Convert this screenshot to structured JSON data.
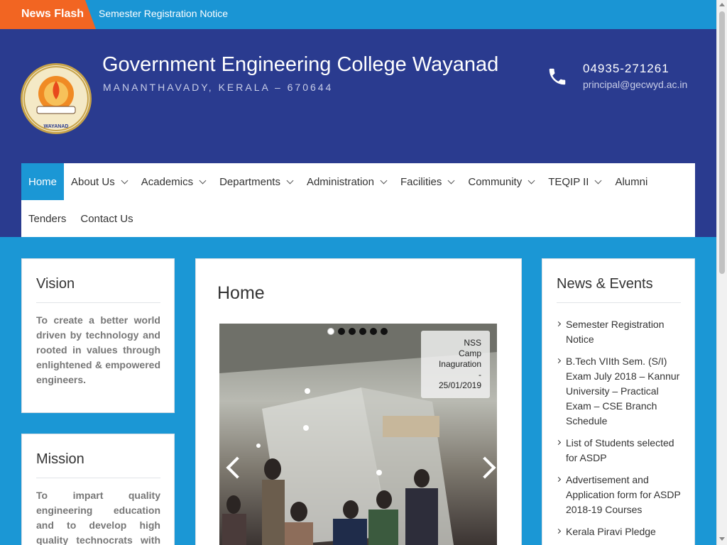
{
  "news_flash": {
    "tag": "News Flash",
    "text": "Semester Registration Notice"
  },
  "header": {
    "title": "Government Engineering College Wayanad",
    "subtitle": "MANANTHAVADY, KERALA – 670644",
    "phone": "04935-271261",
    "email": "principal@gecwyd.ac.in",
    "logo_text": "WAYANAD",
    "logo_motto": "तमसो मा ज्योतिर्गमय"
  },
  "nav": {
    "row1": [
      {
        "label": "Home",
        "active": true,
        "dropdown": false
      },
      {
        "label": "About Us",
        "dropdown": true
      },
      {
        "label": "Academics",
        "dropdown": true
      },
      {
        "label": "Departments",
        "dropdown": true
      },
      {
        "label": "Administration",
        "dropdown": true
      },
      {
        "label": "Facilities",
        "dropdown": true
      },
      {
        "label": "Community",
        "dropdown": true
      },
      {
        "label": "TEQIP II",
        "dropdown": true
      },
      {
        "label": "Alumni",
        "dropdown": false
      }
    ],
    "row2": [
      {
        "label": "Tenders",
        "dropdown": false
      },
      {
        "label": "Contact Us",
        "dropdown": false
      }
    ]
  },
  "vision": {
    "title": "Vision",
    "text": "To create a better world driven by technology and rooted in values through enlightened & empowered engineers."
  },
  "mission": {
    "title": "Mission",
    "text": "To impart quality engineering education and to develop high quality technocrats with ingenuity,"
  },
  "main": {
    "title": "Home",
    "slider": {
      "caption_lines": [
        "NSS",
        "Camp",
        "Inaguration",
        "-",
        "25/01/2019"
      ],
      "dot_count": 6,
      "active_dot": 0
    }
  },
  "news_events": {
    "title": "News & Events",
    "items": [
      "Semester Registration Notice",
      "B.Tech VIIth Sem. (S/I) Exam July 2018 – Kannur University – Practical Exam – CSE Branch Schedule",
      "List of Students selected for ASDP",
      "Advertisement and Application form for ASDP 2018-19 Courses",
      "Kerala Piravi Pledge"
    ]
  },
  "colors": {
    "accent_blue": "#1b97d5",
    "header_navy": "#2a3b8f",
    "news_orange": "#f26522"
  }
}
